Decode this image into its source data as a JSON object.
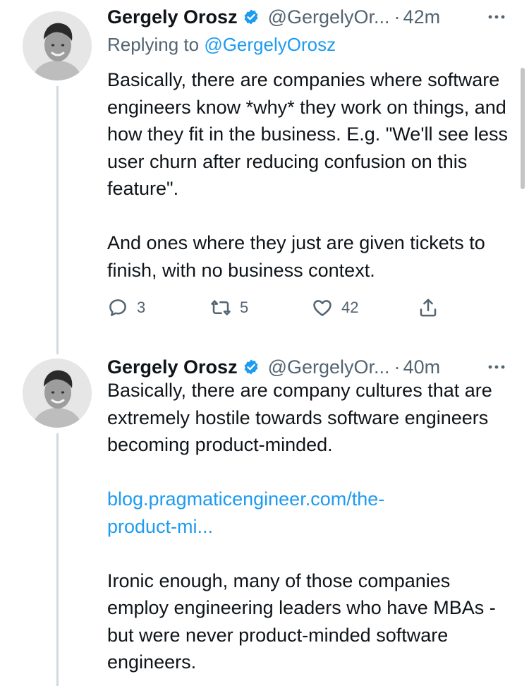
{
  "tweets": [
    {
      "name": "Gergely Orosz",
      "handle": "@GergelyOr...",
      "dot": "·",
      "time": "42m",
      "reply_prefix": "Replying to ",
      "reply_mention": "@GergelyOrosz",
      "paragraphs": [
        "Basically, there are companies where software engineers know *why* they work on things, and how they fit in the business. E.g. \"We'll see less user churn after reducing confusion on this feature\".",
        "And ones where they just are given tickets to finish, with no business context."
      ],
      "counts": {
        "replies": "3",
        "retweets": "5",
        "likes": "42"
      }
    },
    {
      "name": "Gergely Orosz",
      "handle": "@GergelyOr...",
      "dot": "·",
      "time": "40m",
      "paragraph1": "Basically, there are company cultures that are extremely hostile towards software engineers becoming product-minded.",
      "link_line1": "blog.pragmaticengineer.com/the-",
      "link_line2": "product-mi...",
      "paragraph2": "Ironic enough, many of those companies employ engineering leaders who have MBAs - but were never product-minded software engineers."
    }
  ],
  "icons": {
    "verified": "verified-badge-icon",
    "more": "more-horizontal-icon",
    "reply": "reply-icon",
    "retweet": "retweet-icon",
    "like": "heart-icon",
    "share": "share-icon"
  },
  "colors": {
    "accent": "#1d9bf0",
    "secondary_text": "#536471",
    "thread_line": "#cfd9de"
  }
}
